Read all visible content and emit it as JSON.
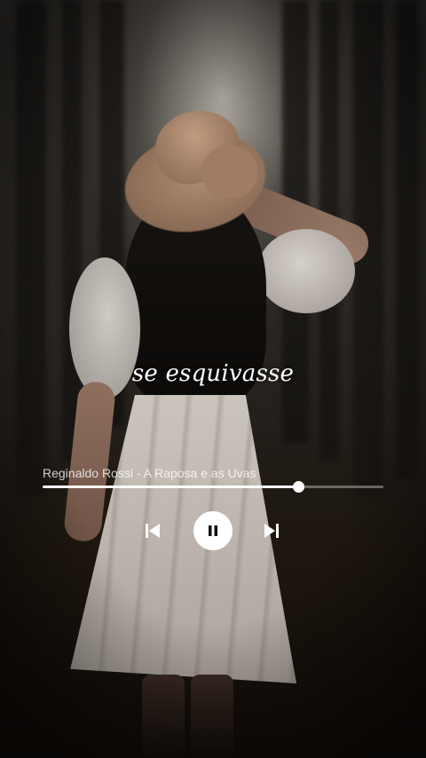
{
  "lyrics": {
    "current_line": "se esquivasse"
  },
  "player": {
    "track_title": "Reginaldo Rossi - A Raposa e as Uvas",
    "progress_fraction": 0.75,
    "state": "playing",
    "icons": {
      "previous": "skip-previous-icon",
      "pause": "pause-icon",
      "next": "skip-next-icon"
    }
  },
  "colors": {
    "foreground": "#ffffff",
    "track_remaining": "rgba(255,255,255,0.35)"
  }
}
